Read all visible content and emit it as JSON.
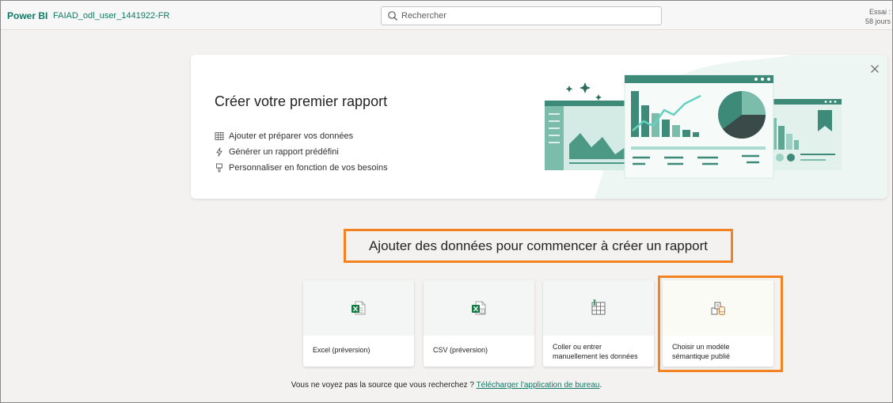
{
  "topbar": {
    "brand": "Power BI",
    "workspace": "FAIAD_odl_user_1441922-FR",
    "search_placeholder": "Rechercher",
    "trial_line1": "Essai :",
    "trial_line2": "58 jours"
  },
  "hero": {
    "title": "Créer votre premier rapport",
    "items": [
      {
        "icon": "table-icon",
        "label": "Ajouter et préparer vos données"
      },
      {
        "icon": "lightning-icon",
        "label": "Générer un rapport prédéfini"
      },
      {
        "icon": "brush-icon",
        "label": "Personnaliser en fonction de vos besoins"
      }
    ]
  },
  "main": {
    "heading": "Ajouter des données pour commencer à créer un rapport",
    "cards": [
      {
        "icon": "excel-icon",
        "label": "Excel (préversion)"
      },
      {
        "icon": "csv-icon",
        "label": "CSV (préversion)"
      },
      {
        "icon": "grid-entry-icon",
        "label": "Coller ou entrer manuellement les données"
      },
      {
        "icon": "semantic-model-icon",
        "label": "Choisir un modèle sémantique publié"
      }
    ],
    "footer_text": "Vous ne voyez pas la source que vous recherchez ? ",
    "footer_link": "Télécharger l'application de bureau",
    "footer_end": "."
  },
  "colors": {
    "brand": "#117865",
    "highlight": "#f58220",
    "teal_dark": "#3e8a78",
    "teal_light": "#e7f3ef"
  }
}
